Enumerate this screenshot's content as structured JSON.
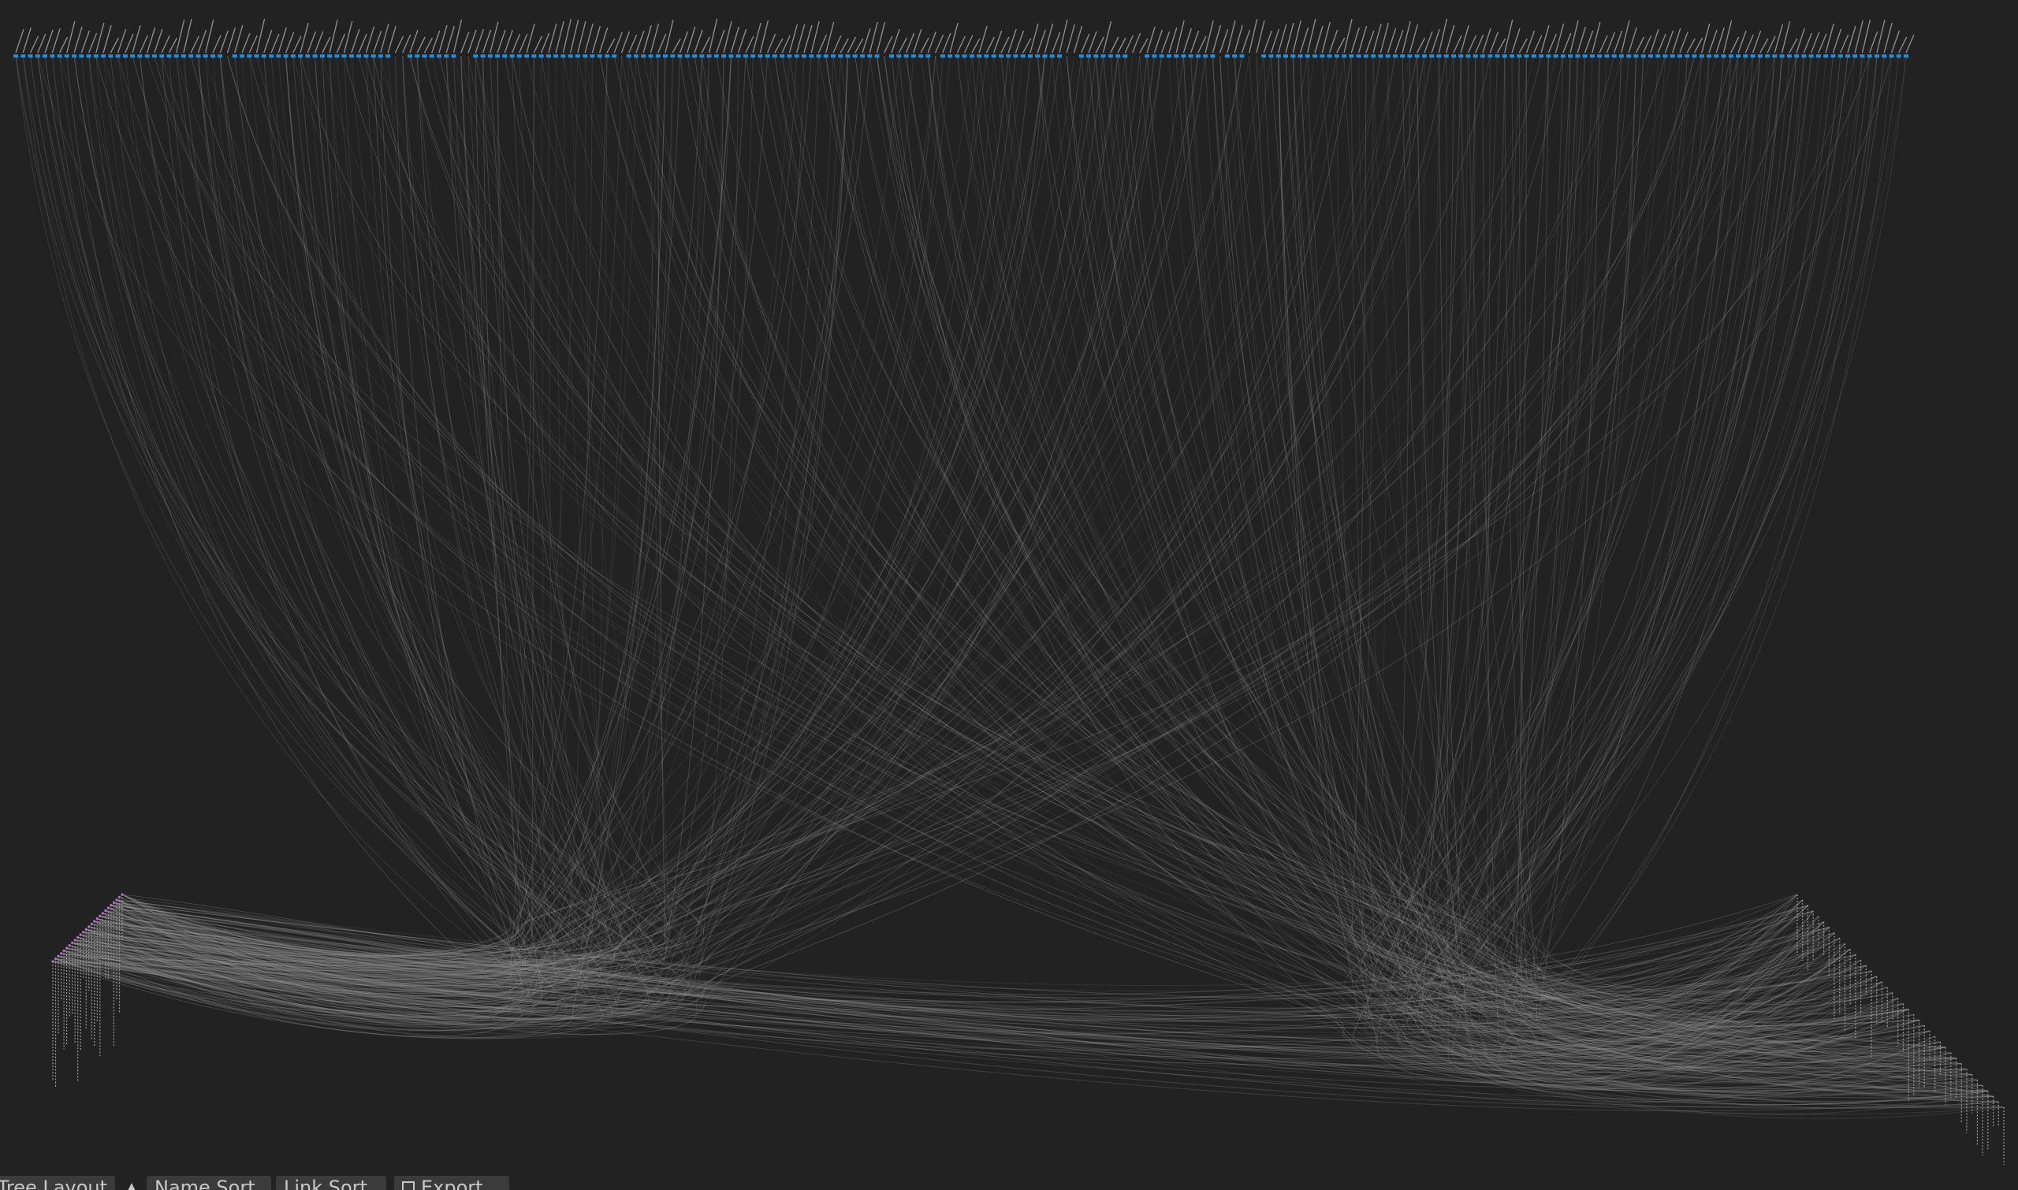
{
  "toolbar": {
    "layout_label": "Tree Layout",
    "layout_dropdown_icon": "chevron-up-icon",
    "name_sort_label": "Name Sort",
    "link_sort_label": "Link Sort",
    "export_label": "Export",
    "export_icon": "save-icon"
  },
  "graph": {
    "type": "hierarchical-edge-bundling",
    "node_color": "#1e8fe0",
    "edge_color": "#9a9a9a",
    "background": "#222222",
    "top_group": {
      "orientation": "horizontal",
      "node_count": 260
    },
    "left_group": {
      "orientation": "diagonal",
      "node_count": 26
    },
    "right_group": {
      "orientation": "diagonal",
      "node_count": 40
    }
  }
}
